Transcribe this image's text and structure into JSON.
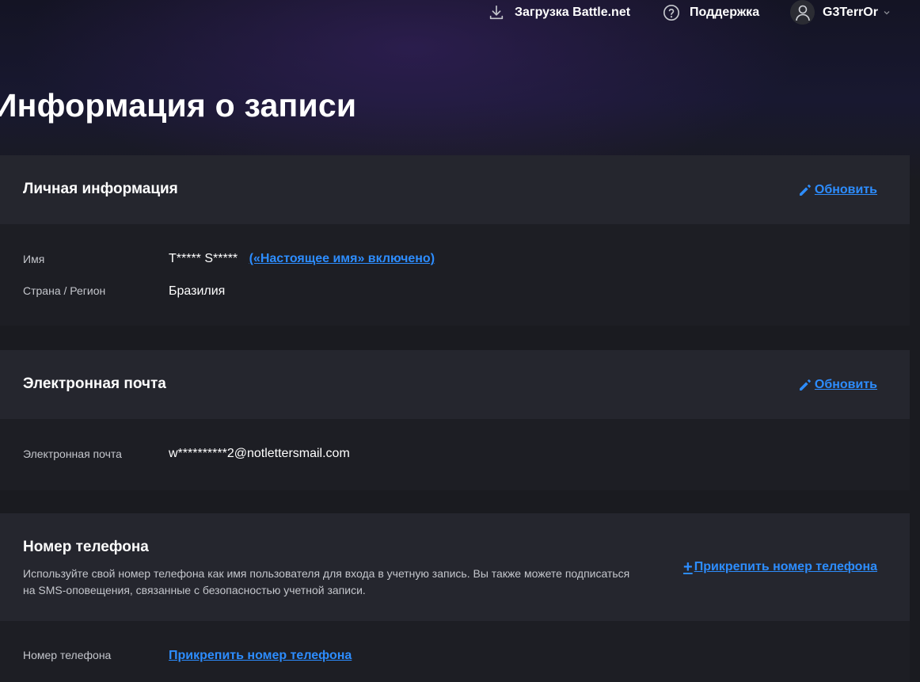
{
  "nav": {
    "download_label": "Загрузка Battle.net",
    "download_icon": "download-icon",
    "support_label": "Поддержка",
    "support_icon": "help-circle-icon",
    "account_name": "G3TerrOr",
    "account_icon": "user-icon"
  },
  "page": {
    "title": "Информация о записи"
  },
  "personal": {
    "title": "Личная информация",
    "update_label": "Обновить",
    "name_label": "Имя",
    "name_value": "T***** S*****",
    "real_id_link": "(«Настоящее имя» включено)",
    "country_label": "Страна / Регион",
    "country_value": "Бразилия"
  },
  "email": {
    "title": "Электронная почта",
    "update_label": "Обновить",
    "email_label": "Электронная почта",
    "email_value": "w**********2@notlettersmail.com"
  },
  "phone": {
    "title": "Номер телефона",
    "description": "Используйте свой номер телефона как имя пользователя для входа в учетную запись. Вы также можете подписаться на SMS-оповещения, связанные с безопасностью учетной записи.",
    "attach_label": "Прикрепить номер телефона",
    "phone_label": "Номер телефона",
    "phone_value_link": "Прикрепить номер телефона"
  },
  "colors": {
    "accent": "#2d8dff",
    "background": "#1a1b20",
    "card_header": "#25262e",
    "card_body": "#1d1e24"
  }
}
